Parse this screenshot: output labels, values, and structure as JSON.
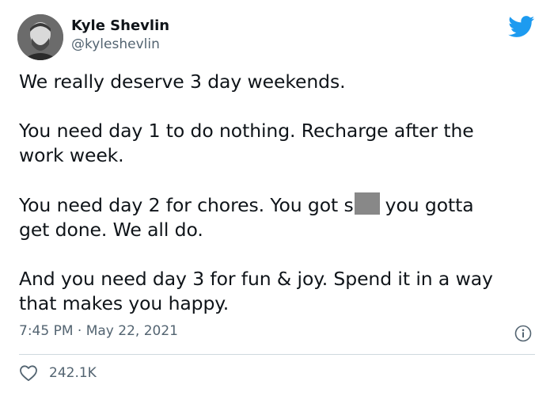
{
  "author": {
    "name": "Kyle Shevlin",
    "handle": "@kyleshevlin"
  },
  "tweet": {
    "paragraphs": [
      "We really deserve 3 day weekends.",
      "You need day 1 to do nothing. Recharge after the",
      "work week.",
      "You need day 2 for chores. You got s",
      "you gotta",
      "get done. We all do.",
      "And you need day 3 for fun & joy. Spend it in a way",
      "that makes you happy."
    ],
    "time": "7:45 PM",
    "separator": "·",
    "date": "May 22, 2021"
  },
  "engagement": {
    "likes": "242.1K"
  },
  "icons": {
    "brand": "twitter-bird-icon",
    "info": "info-icon",
    "like": "heart-icon"
  },
  "colors": {
    "twitter_blue": "#1d9bf0",
    "text": "#0f1419",
    "muted": "#536471",
    "redaction": "#888888"
  }
}
